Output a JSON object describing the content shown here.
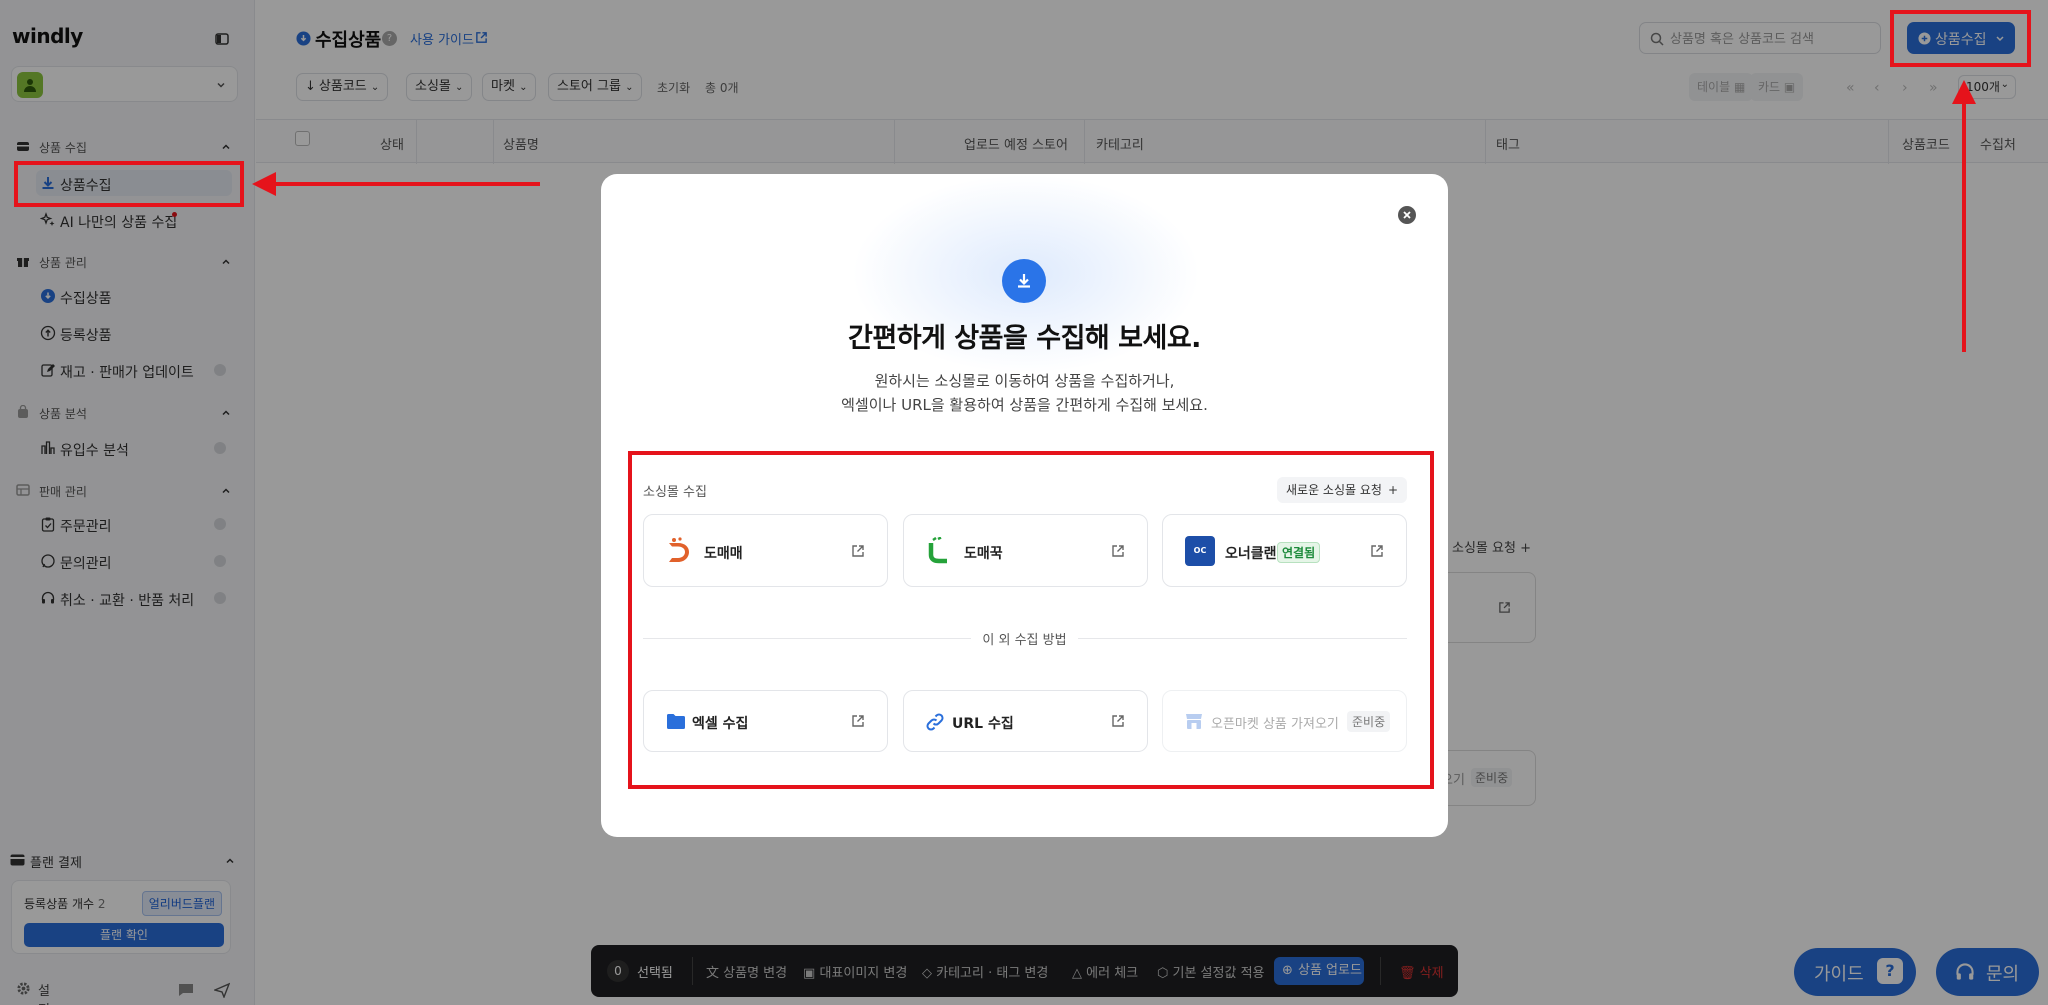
{
  "app": {
    "logo": "windly"
  },
  "sidebar": {
    "sections": [
      {
        "label": "상품 수집",
        "items": [
          {
            "label": "상품수집"
          },
          {
            "label": "AI 나만의 상품 수집"
          }
        ]
      },
      {
        "label": "상품 관리",
        "items": [
          {
            "label": "수집상품"
          },
          {
            "label": "등록상품"
          },
          {
            "label": "재고 · 판매가 업데이트"
          }
        ]
      },
      {
        "label": "상품 분석",
        "items": [
          {
            "label": "유입수 분석"
          }
        ]
      },
      {
        "label": "판매 관리",
        "items": [
          {
            "label": "주문관리"
          },
          {
            "label": "문의관리"
          },
          {
            "label": "취소 · 교환 · 반품 처리"
          }
        ]
      }
    ],
    "plan": {
      "title": "플랜 결제",
      "count_label": "등록상품 개수",
      "count": "2",
      "badge": "얼리버드플랜",
      "button": "플랜 확인"
    },
    "settings": "설정"
  },
  "header": {
    "title": "수집상품",
    "help": "?",
    "guide_link": "사용 가이드",
    "search_placeholder": "상품명 혹은 상품코드 검색",
    "collect_button": "상품수집"
  },
  "filters": {
    "sort": "상품코드",
    "chips": [
      "소싱몰",
      "마켓",
      "스토어 그룹"
    ],
    "reset": "초기화",
    "total": "총 0개",
    "view_table": "테이블",
    "view_card": "카드",
    "per_page": "100개"
  },
  "table": {
    "columns": [
      "상태",
      "상품명",
      "업로드 예정 스토어",
      "카테고리",
      "태그",
      "상품코드",
      "수집처"
    ]
  },
  "background_fragments": {
    "request": "소싱몰 요청",
    "import": "오기",
    "soon": "준비중"
  },
  "bottom_bar": {
    "count": "0",
    "selected": "선택됨",
    "actions": [
      "상품명 변경",
      "대표이미지 변경",
      "카테고리 · 태그 변경",
      "에러 체크",
      "기본 설정값 적용"
    ],
    "upload": "상품 업로드",
    "delete": "삭제"
  },
  "floating": {
    "guide": "가이드",
    "ask": "문의"
  },
  "modal": {
    "title": "간편하게 상품을 수집해 보세요.",
    "desc_line1": "원하시는 소싱몰로 이동하여 상품을 수집하거나,",
    "desc_line2": "엑셀이나 URL을 활용하여 상품을 간편하게 수집해 보세요.",
    "sourcing_label": "소싱몰 수집",
    "request_button": "새로운 소싱몰 요청",
    "malls": [
      {
        "name": "도매매"
      },
      {
        "name": "도매꾹"
      },
      {
        "name": "오너클랜",
        "status": "연결됨"
      }
    ],
    "other_label": "이 외 수집 방법",
    "methods": [
      {
        "name": "엑셀 수집"
      },
      {
        "name": "URL 수집"
      },
      {
        "name": "오픈마켓 상품 가져오기",
        "status": "준비중"
      }
    ]
  },
  "colors": {
    "accent": "#2a6fdb",
    "annotation": "#e5131b",
    "connected": "#1c8a3a"
  }
}
